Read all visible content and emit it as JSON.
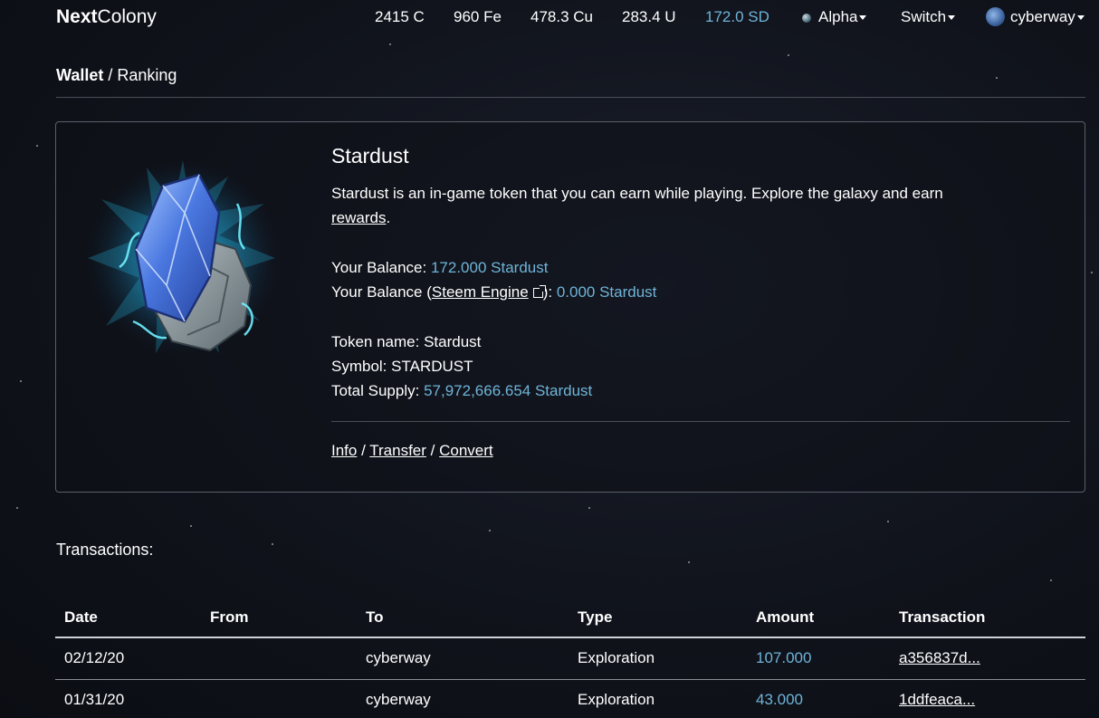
{
  "navbar": {
    "brand_bold": "Next",
    "brand_rest": "Colony",
    "resources": [
      "2415 C",
      "960 Fe",
      "478.3 Cu",
      "283.4 U",
      "172.0 SD"
    ],
    "planet": "Alpha",
    "switch": "Switch",
    "user": "cyberway"
  },
  "breadcrumb": {
    "active": "Wallet",
    "separator": "/",
    "link": "Ranking"
  },
  "token": {
    "title": "Stardust",
    "description": "Stardust is an in-game token that you can earn while playing. Explore the galaxy and earn",
    "rewards_link": "rewards",
    "description_end": ".",
    "balance_label": "Your Balance:",
    "balance_value": "172.000 Stardust",
    "engine_label_pre": "Your Balance (",
    "engine_link": "Steem Engine",
    "engine_label_post": "):",
    "engine_value": "0.000 Stardust",
    "token_name_label": "Token name:",
    "token_name": "Stardust",
    "symbol_label": "Symbol:",
    "symbol": "STARDUST",
    "supply_label": "Total Supply:",
    "supply_value": "57,972,666.654 Stardust",
    "actions": {
      "info": "Info",
      "transfer": "Transfer",
      "convert": "Convert",
      "sep": "/"
    }
  },
  "transactions": {
    "label": "Transactions:",
    "columns": [
      "Date",
      "From",
      "To",
      "Type",
      "Amount",
      "Transaction"
    ],
    "rows": [
      {
        "date": "02/12/20",
        "from": "",
        "to": "cyberway",
        "type": "Exploration",
        "amount": "107.000",
        "tx": "a356837d..."
      },
      {
        "date": "01/31/20",
        "from": "",
        "to": "cyberway",
        "type": "Exploration",
        "amount": "43.000",
        "tx": "1ddfeaca..."
      }
    ]
  }
}
